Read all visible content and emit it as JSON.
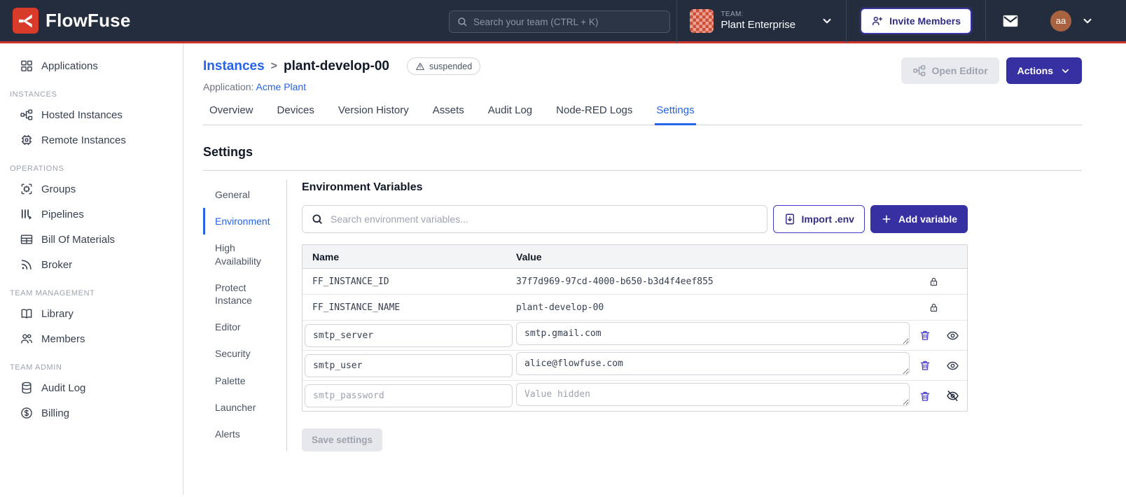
{
  "topbar": {
    "brand": "FlowFuse",
    "search_placeholder": "Search your team (CTRL + K)",
    "team_label": "TEAM:",
    "team_name": "Plant Enterprise",
    "invite_button": "Invite Members",
    "avatar_initials": "aa"
  },
  "sidebar": {
    "groups": [
      {
        "label": "",
        "items": [
          {
            "icon": "applications-icon",
            "label": "Applications"
          }
        ]
      },
      {
        "label": "INSTANCES",
        "items": [
          {
            "icon": "hosted-instances-icon",
            "label": "Hosted Instances"
          },
          {
            "icon": "remote-instances-icon",
            "label": "Remote Instances"
          }
        ]
      },
      {
        "label": "OPERATIONS",
        "items": [
          {
            "icon": "groups-icon",
            "label": "Groups"
          },
          {
            "icon": "pipelines-icon",
            "label": "Pipelines"
          },
          {
            "icon": "bill-of-materials-icon",
            "label": "Bill Of Materials"
          },
          {
            "icon": "broker-icon",
            "label": "Broker"
          }
        ]
      },
      {
        "label": "TEAM MANAGEMENT",
        "items": [
          {
            "icon": "library-icon",
            "label": "Library"
          },
          {
            "icon": "members-icon",
            "label": "Members"
          }
        ]
      },
      {
        "label": "TEAM ADMIN",
        "items": [
          {
            "icon": "audit-log-icon",
            "label": "Audit Log"
          },
          {
            "icon": "billing-icon",
            "label": "Billing"
          }
        ]
      }
    ]
  },
  "page": {
    "breadcrumb": {
      "parent": "Instances",
      "separator": ">",
      "current": "plant-develop-00"
    },
    "status_badge": "suspended",
    "application_label": "Application:",
    "application_name": "Acme Plant",
    "open_editor_button": "Open Editor",
    "actions_button": "Actions"
  },
  "tabs": [
    {
      "label": "Overview"
    },
    {
      "label": "Devices"
    },
    {
      "label": "Version History"
    },
    {
      "label": "Assets"
    },
    {
      "label": "Audit Log"
    },
    {
      "label": "Node-RED Logs"
    },
    {
      "label": "Settings"
    }
  ],
  "settings": {
    "title": "Settings",
    "nav": [
      {
        "label": "General"
      },
      {
        "label": "Environment"
      },
      {
        "label": "High Availability"
      },
      {
        "label": "Protect Instance"
      },
      {
        "label": "Editor"
      },
      {
        "label": "Security"
      },
      {
        "label": "Palette"
      },
      {
        "label": "Launcher"
      },
      {
        "label": "Alerts"
      }
    ],
    "active_nav": "Environment"
  },
  "env": {
    "title": "Environment Variables",
    "search_placeholder": "Search environment variables...",
    "import_button": "Import .env",
    "add_button": "Add variable",
    "columns": {
      "name": "Name",
      "value": "Value"
    },
    "locked_rows": [
      {
        "name": "FF_INSTANCE_ID",
        "value": "37f7d969-97cd-4000-b650-b3d4f4eef855"
      },
      {
        "name": "FF_INSTANCE_NAME",
        "value": "plant-develop-00"
      }
    ],
    "editable_rows": [
      {
        "name": "smtp_server",
        "value": "smtp.gmail.com"
      },
      {
        "name": "smtp_user",
        "value": "alice@flowfuse.com"
      },
      {
        "name_placeholder": "smtp_password",
        "value_placeholder": "Value hidden"
      }
    ],
    "save_button": "Save settings"
  },
  "colors": {
    "header_bg": "#232d3e",
    "brand_red": "#cf342c",
    "button_indigo": "#3730a3",
    "link_blue": "#2563eb",
    "avatar_brown": "#a9623f"
  }
}
